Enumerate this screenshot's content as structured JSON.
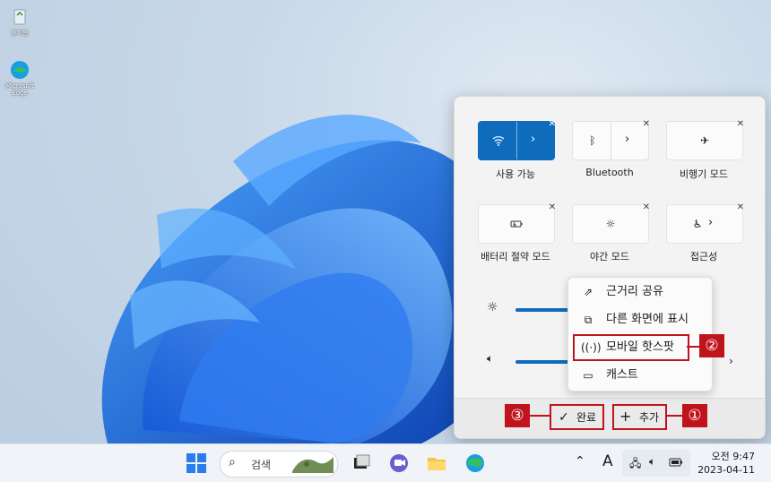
{
  "desktop": {
    "icons": [
      {
        "label": "휴지통"
      },
      {
        "label": "Microsoft Edge"
      }
    ]
  },
  "quick_settings": {
    "tiles": [
      {
        "label": "사용 가능",
        "icon": "wifi-icon",
        "active": true
      },
      {
        "label": "Bluetooth",
        "icon": "bluetooth-icon",
        "active": false
      },
      {
        "label": "비행기 모드",
        "icon": "airplane-icon",
        "active": false
      },
      {
        "label": "배터리 절약 모드",
        "icon": "battery-saver-icon",
        "active": false
      },
      {
        "label": "야간 모드",
        "icon": "night-light-icon",
        "active": false
      },
      {
        "label": "접근성",
        "icon": "accessibility-icon",
        "active": false
      }
    ],
    "brightness_icon": "sun-icon",
    "volume_icon": "speaker-icon",
    "footer": {
      "done_label": "완료",
      "add_label": "추가"
    }
  },
  "add_menu": {
    "items": [
      {
        "label": "근거리 공유",
        "icon": "nearby-share-icon"
      },
      {
        "label": "다른 화면에 표시",
        "icon": "project-icon"
      },
      {
        "label": "모바일 핫스팟",
        "icon": "hotspot-icon"
      },
      {
        "label": "캐스트",
        "icon": "cast-icon"
      }
    ]
  },
  "annotations": {
    "badge1": "①",
    "badge2": "②",
    "badge3": "③",
    "color": "#c0141c"
  },
  "taskbar": {
    "search_label": "검색",
    "ime_label": "A",
    "time": "오전 9:47",
    "date": "2023-04-11"
  },
  "accent_color": "#0f6cbd"
}
